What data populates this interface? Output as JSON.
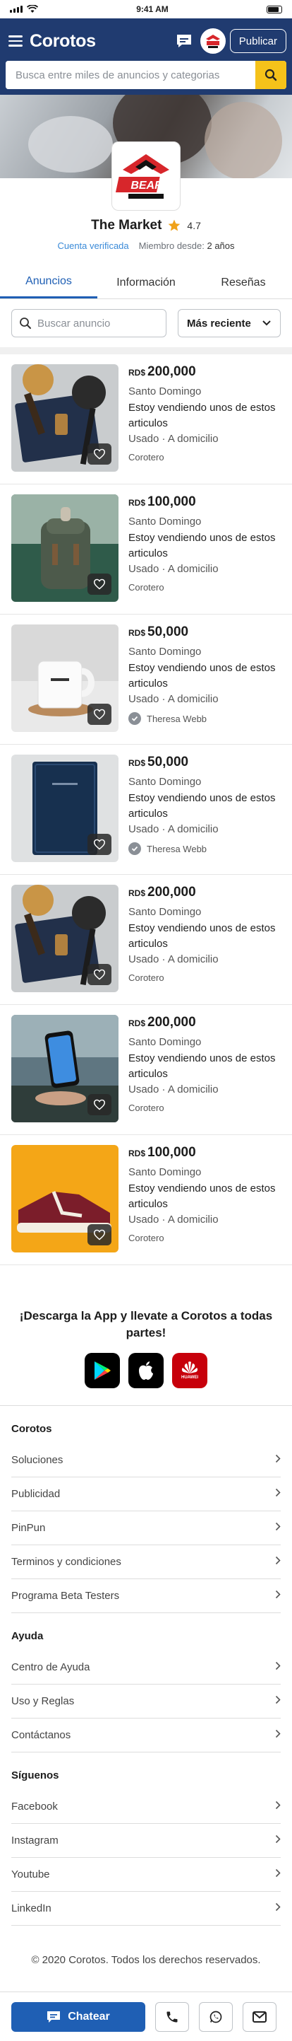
{
  "status_bar": {
    "time": "9:41 AM"
  },
  "header": {
    "logo": "Corotos",
    "publish_label": "Publicar",
    "search_placeholder": "Busca entre miles de anuncios y categorias"
  },
  "store": {
    "name": "The Market",
    "rating": "4.7",
    "verified": "Cuenta verificada",
    "member_since_label": "Miembro desde:",
    "member_since_value": "2 años",
    "logo_text": "BEAR"
  },
  "tabs": [
    "Anuncios",
    "Información",
    "Reseñas"
  ],
  "filters": {
    "search_placeholder": "Buscar anuncio",
    "sort_label": "Más reciente"
  },
  "listings": [
    {
      "currency": "RD$",
      "price": "200,000",
      "location": "Santo Domingo",
      "desc": "Estoy vendiendo unos de estos articulos",
      "condition": "Usado · A domicilio",
      "seller": "Corotero",
      "verified": false,
      "image": "kitchen-utensils"
    },
    {
      "currency": "RD$",
      "price": "100,000",
      "location": "Santo Domingo",
      "desc": "Estoy vendiendo unos de estos articulos",
      "condition": "Usado · A domicilio",
      "seller": "Corotero",
      "verified": false,
      "image": "backpack"
    },
    {
      "currency": "RD$",
      "price": "50,000",
      "location": "Santo Domingo",
      "desc": "Estoy vendiendo unos de estos articulos",
      "condition": "Usado · A domicilio",
      "seller": "Theresa Webb",
      "verified": true,
      "image": "white-mug"
    },
    {
      "currency": "RD$",
      "price": "50,000",
      "location": "Santo Domingo",
      "desc": "Estoy vendiendo unos de estos articulos",
      "condition": "Usado · A domicilio",
      "seller": "Theresa Webb",
      "verified": true,
      "image": "notebook"
    },
    {
      "currency": "RD$",
      "price": "200,000",
      "location": "Santo Domingo",
      "desc": "Estoy vendiendo unos de estos articulos",
      "condition": "Usado · A domicilio",
      "seller": "Corotero",
      "verified": false,
      "image": "kitchen-utensils"
    },
    {
      "currency": "RD$",
      "price": "200,000",
      "location": "Santo Domingo",
      "desc": "Estoy vendiendo unos de estos articulos",
      "condition": "Usado · A domicilio",
      "seller": "Corotero",
      "verified": false,
      "image": "smartphone"
    },
    {
      "currency": "RD$",
      "price": "100,000",
      "location": "Santo Domingo",
      "desc": "Estoy vendiendo unos de estos articulos",
      "condition": "Usado · A domicilio",
      "seller": "Corotero",
      "verified": false,
      "image": "sneaker"
    }
  ],
  "app_promo": {
    "title": "¡Descarga la App y llevate a Corotos a todas partes!",
    "stores": [
      "google-play-icon",
      "apple-icon",
      "huawei-icon"
    ],
    "huawei_label": "HUAWEI"
  },
  "footer": {
    "sections": [
      {
        "title": "Corotos",
        "links": [
          "Soluciones",
          "Publicidad",
          "PinPun",
          "Terminos y condiciones",
          "Programa Beta Testers"
        ]
      },
      {
        "title": "Ayuda",
        "links": [
          "Centro de Ayuda",
          "Uso y Reglas",
          "Contáctanos"
        ]
      },
      {
        "title": "Síguenos",
        "links": [
          "Facebook",
          "Instagram",
          "Youtube",
          "LinkedIn"
        ]
      }
    ],
    "copyright": "© 2020 Corotos. Todos los derechos reservados."
  },
  "bottom_bar": {
    "chat_label": "Chatear"
  },
  "colors": {
    "primary": "#203b70",
    "accent": "#f5c21a",
    "link": "#1f5fb4",
    "star": "#f0a21a"
  }
}
